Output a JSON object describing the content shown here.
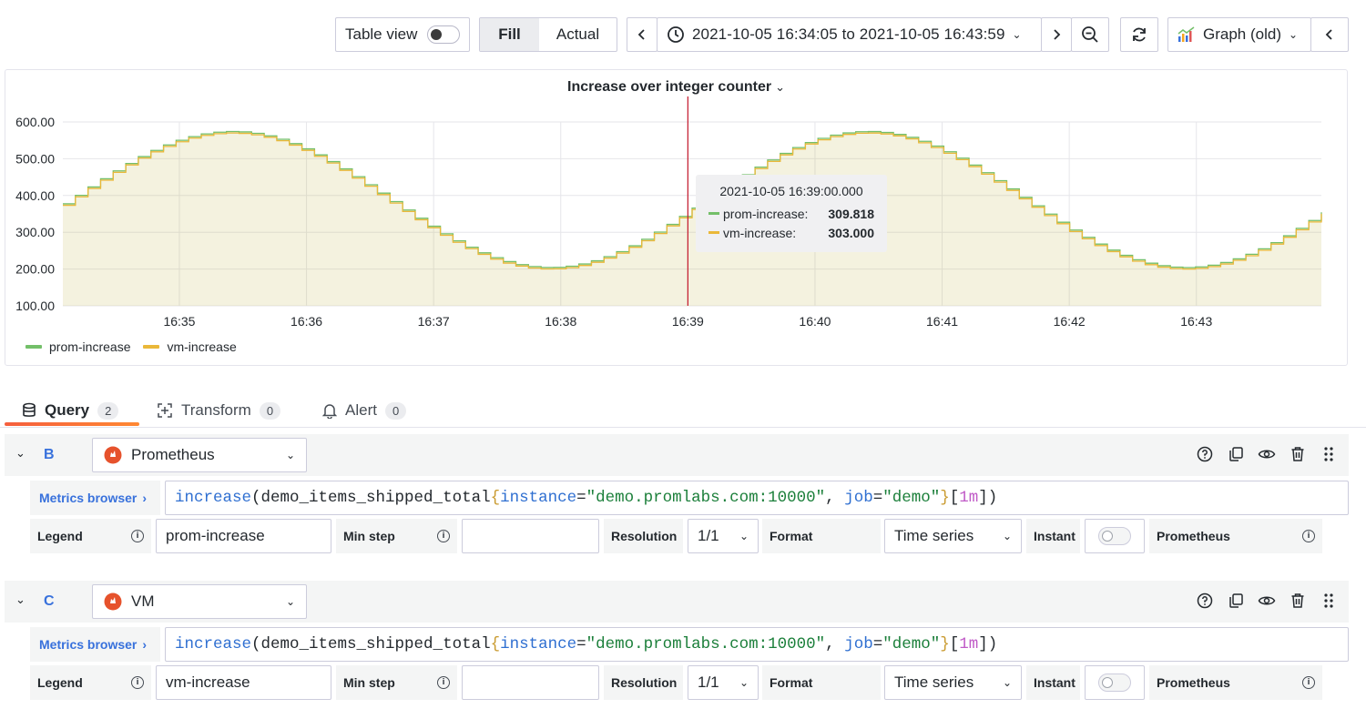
{
  "toolbar": {
    "table_view_label": "Table view",
    "fill_label": "Fill",
    "actual_label": "Actual",
    "time_range": "2021-10-05 16:34:05 to 2021-10-05 16:43:59",
    "viz_label": "Graph (old)"
  },
  "panel": {
    "title": "Increase over integer counter"
  },
  "chart_data": {
    "type": "line",
    "x_ticks": [
      "16:35",
      "16:36",
      "16:37",
      "16:38",
      "16:39",
      "16:40",
      "16:41",
      "16:42",
      "16:43"
    ],
    "y_ticks": [
      "600.00",
      "500.00",
      "400.00",
      "300.00",
      "200.00",
      "100.00"
    ],
    "ylim": [
      100,
      600
    ],
    "xlim": [
      "16:34:05",
      "16:43:59"
    ],
    "grid": true,
    "legend_position": "bottom-left",
    "fill": true,
    "series": [
      {
        "name": "prom-increase",
        "color": "#73bf69"
      },
      {
        "name": "vm-increase",
        "color": "#eab839"
      }
    ],
    "cursor_time": "16:39",
    "cursor_color": "#c4162a"
  },
  "tooltip": {
    "time": "2021-10-05 16:39:00.000",
    "rows": [
      {
        "name": "prom-increase:",
        "value": "309.818",
        "color": "#73bf69"
      },
      {
        "name": "vm-increase:",
        "value": "303.000",
        "color": "#eab839"
      }
    ]
  },
  "tabs": [
    {
      "label": "Query",
      "count": "2"
    },
    {
      "label": "Transform",
      "count": "0"
    },
    {
      "label": "Alert",
      "count": "0"
    }
  ],
  "queries": [
    {
      "letter": "B",
      "datasource": "Prometheus",
      "metrics_browser": "Metrics browser",
      "expr": {
        "func": "increase",
        "metric": "demo_items_shipped_total",
        "label1": "instance",
        "value1": "\"demo.promlabs.com:10000\"",
        "label2": "job",
        "value2": "\"demo\"",
        "range": "1m"
      },
      "legend_label": "Legend",
      "legend_value": "prom-increase",
      "min_step_label": "Min step",
      "min_step_value": "",
      "resolution_label": "Resolution",
      "resolution_value": "1/1",
      "format_label": "Format",
      "format_value": "Time series",
      "instant_label": "Instant",
      "type_label": "Prometheus"
    },
    {
      "letter": "C",
      "datasource": "VM",
      "metrics_browser": "Metrics browser",
      "expr": {
        "func": "increase",
        "metric": "demo_items_shipped_total",
        "label1": "instance",
        "value1": "\"demo.promlabs.com:10000\"",
        "label2": "job",
        "value2": "\"demo\"",
        "range": "1m"
      },
      "legend_label": "Legend",
      "legend_value": "vm-increase",
      "min_step_label": "Min step",
      "min_step_value": "",
      "resolution_label": "Resolution",
      "resolution_value": "1/1",
      "format_label": "Format",
      "format_value": "Time series",
      "instant_label": "Instant",
      "type_label": "Prometheus"
    }
  ]
}
